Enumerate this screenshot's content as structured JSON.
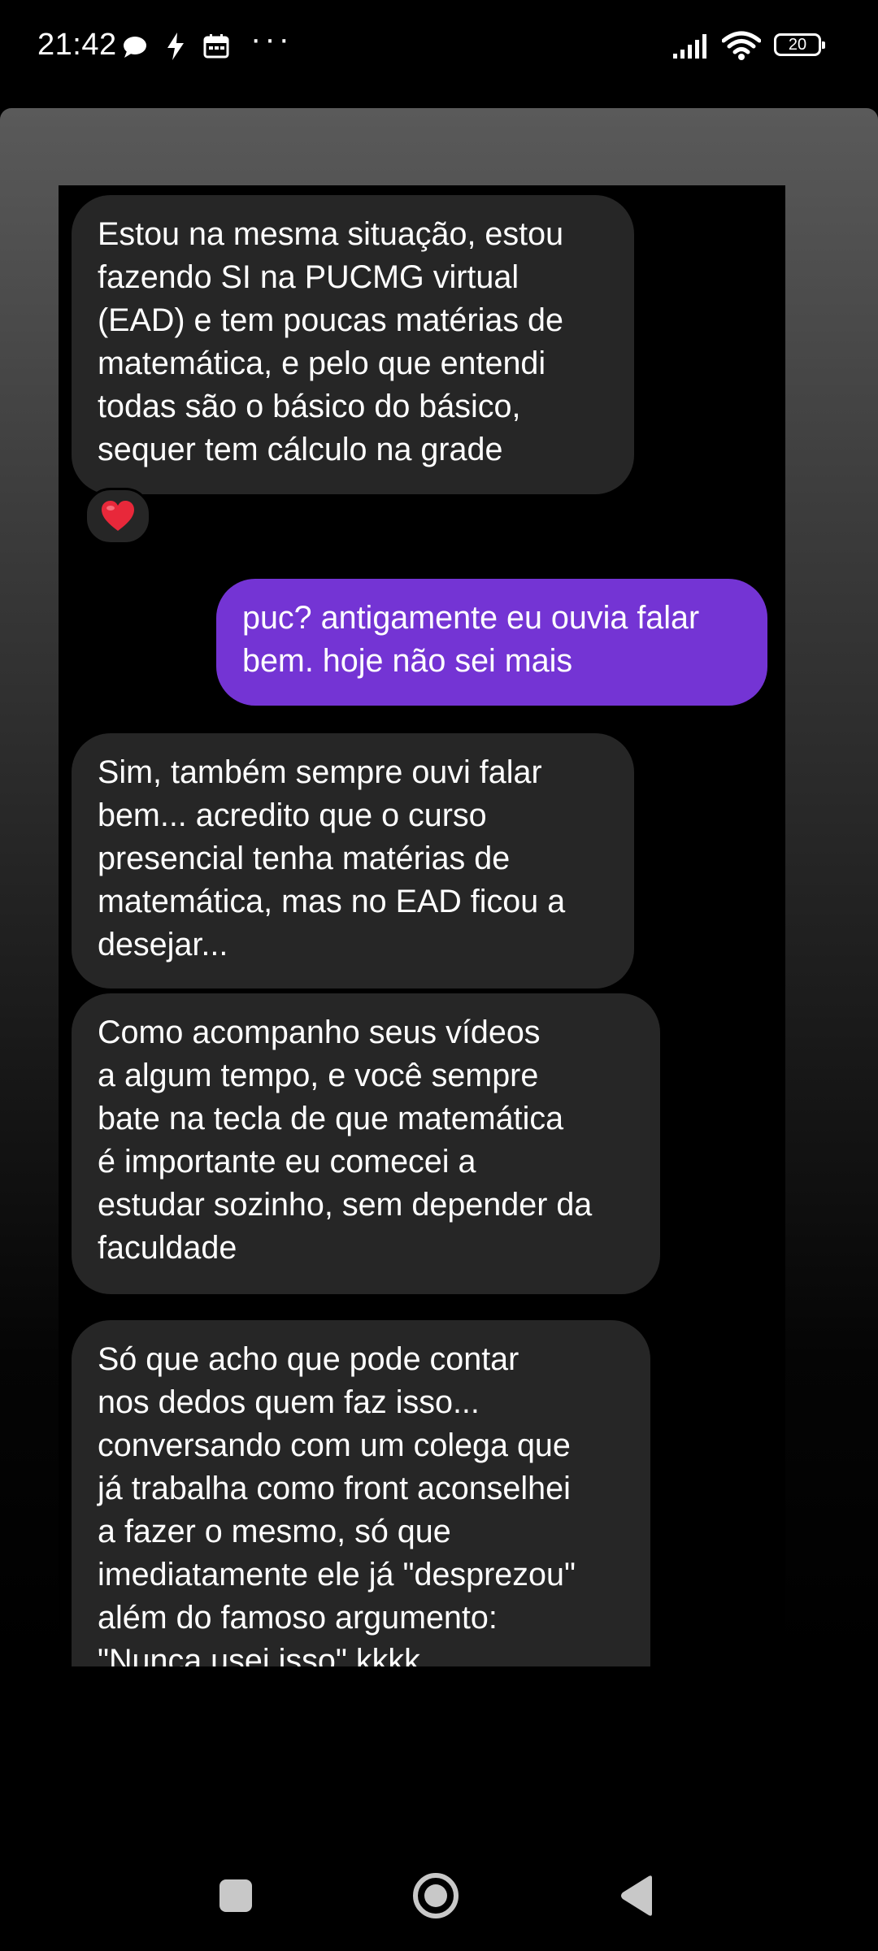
{
  "status_bar": {
    "time": "21:42",
    "icons": [
      "chat-bubble-icon",
      "charging-bolt-icon",
      "calendar-icon",
      "more-dots-icon",
      "signal-icon",
      "wifi-icon",
      "battery-icon"
    ],
    "more": "···",
    "battery_level": "20"
  },
  "chat": {
    "messages": [
      {
        "direction": "incoming",
        "text": "Estou na mesma situação, estou\nfazendo SI na PUCMG virtual\n(EAD) e tem poucas matérias de\nmatemática, e pelo que entendi\ntodas são o básico do básico,\nsequer tem cálculo na grade",
        "reaction": "heart-icon"
      },
      {
        "direction": "outgoing",
        "text": "puc? antigamente eu ouvia falar\nbem. hoje não sei mais"
      },
      {
        "direction": "incoming",
        "text": "Sim, também sempre ouvi falar\nbem... acredito que o curso\npresencial tenha matérias de\nmatemática, mas no EAD ficou a\ndesejar..."
      },
      {
        "direction": "incoming",
        "text": "Como acompanho seus vídeos\na algum tempo, e você sempre\nbate na tecla de que matemática\né importante eu comecei a\nestudar sozinho, sem depender da\nfaculdade"
      },
      {
        "direction": "incoming",
        "text": "Só que acho que pode contar\nnos dedos quem faz isso...\nconversando com um colega que\njá trabalha como front aconselhei\na fazer o mesmo, só que\nimediatamente ele já \"desprezou\"\nalém do famoso argumento:\n\"Nunca usei isso\" kkkk"
      }
    ]
  },
  "nav_bar": {
    "buttons": [
      "recents-square-icon",
      "home-circle-icon",
      "back-triangle-icon"
    ]
  },
  "colors": {
    "incoming_bubble": "#262626",
    "outgoing_bubble": "#7434d4",
    "reaction_heart": "#e8283a"
  }
}
